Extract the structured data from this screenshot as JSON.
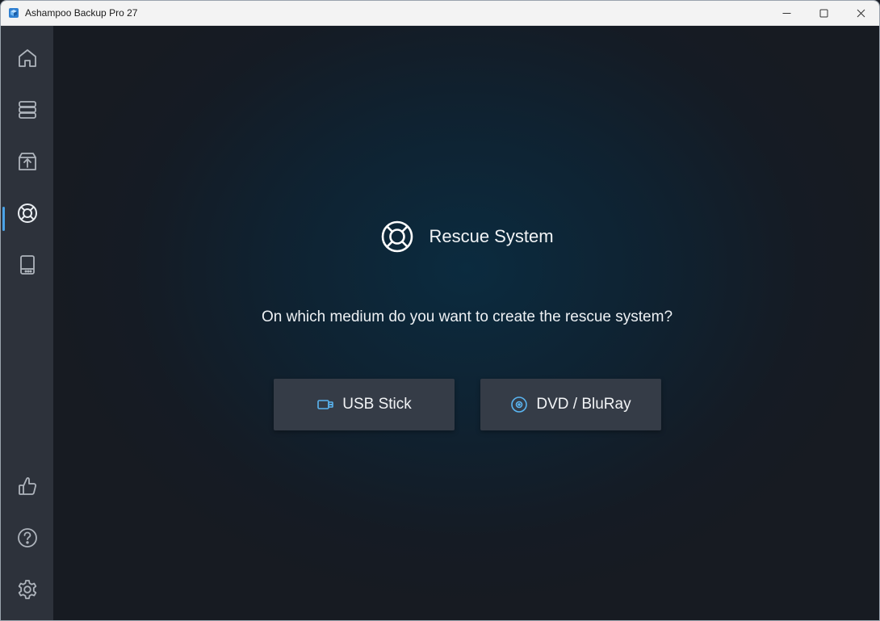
{
  "window": {
    "title": "Ashampoo Backup Pro 27",
    "controls": [
      "minimize-icon",
      "maximize-icon",
      "close-icon"
    ]
  },
  "sidebar": {
    "items": [
      {
        "icon": "home-icon",
        "active": false
      },
      {
        "icon": "storage-icon",
        "active": false
      },
      {
        "icon": "restore-box-icon",
        "active": false
      },
      {
        "icon": "lifebuoy-icon",
        "active": true
      },
      {
        "icon": "drive-icon",
        "active": false
      },
      {
        "icon": "thumbs-up-icon",
        "active": false
      },
      {
        "icon": "help-icon",
        "active": false
      },
      {
        "icon": "settings-icon",
        "active": false
      }
    ]
  },
  "main": {
    "title": "Rescue System",
    "title_icon": "lifebuoy-icon",
    "question": "On which medium do you want to create the rescue system?",
    "options": [
      {
        "label": "USB Stick",
        "icon": "usb-stick-icon"
      },
      {
        "label": "DVD / BluRay",
        "icon": "disc-icon"
      }
    ]
  },
  "colors": {
    "accent": "#4aa3e8",
    "sidebar_bg": "#2d323b",
    "button_bg": "#353c47",
    "titlebar_bg": "#f3f3f3"
  }
}
